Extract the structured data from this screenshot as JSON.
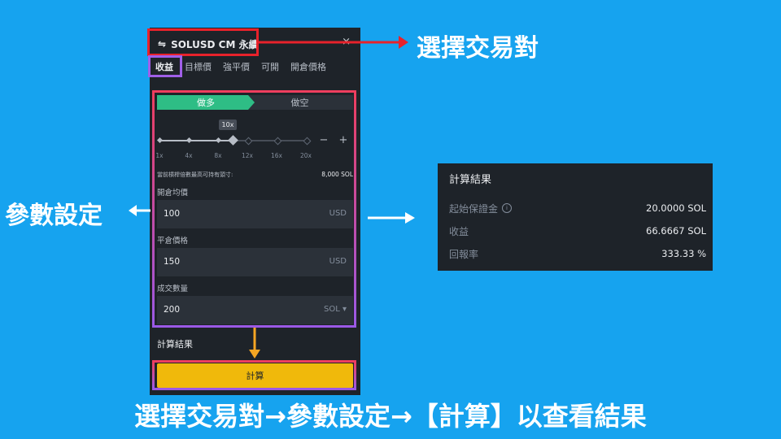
{
  "calculator": {
    "pair_title": "SOLUSD CM 永續",
    "swap_icon": "⇋",
    "close_icon": "×",
    "tabs": [
      "收益",
      "目標價",
      "強平價",
      "可開",
      "開倉價格"
    ],
    "side": {
      "long": "做多",
      "short": "做空"
    },
    "leverage": {
      "badge": "10x",
      "ticks": [
        "1x",
        "4x",
        "8x",
        "12x",
        "16x",
        "20x"
      ],
      "min": 1,
      "max": 20,
      "value": 10,
      "minus": "−",
      "plus": "+"
    },
    "max_position": {
      "label": "當前槓桿倍數最高可持有頭寸:",
      "value": "8,000 SOL"
    },
    "fields": [
      {
        "label": "開倉均價",
        "value": "100",
        "unit": "USD"
      },
      {
        "label": "平倉價格",
        "value": "150",
        "unit": "USD"
      },
      {
        "label": "成交數量",
        "value": "200",
        "unit": "SOL ▾"
      }
    ],
    "result_label": "計算結果",
    "calculate_button": "計算"
  },
  "results_card": {
    "title": "計算結果",
    "rows": [
      {
        "label": "起始保證金",
        "value": "20.0000 SOL",
        "info_icon": "i"
      },
      {
        "label": "收益",
        "value": "66.6667 SOL"
      },
      {
        "label": "回報率",
        "value": "333.33 %"
      }
    ]
  },
  "annotations": {
    "select_pair": "選擇交易對",
    "set_params": "參數設定",
    "caption": "選擇交易對→參數設定→【計算】以查看結果"
  },
  "colors": {
    "background": "#16a3ef",
    "panel": "#1e2329",
    "long_green": "#2ebd85",
    "button_yellow": "#f0b90b",
    "box_red": "#e8222b",
    "box_purple": "#a05fe8",
    "arrow_orange": "#f5a623"
  }
}
